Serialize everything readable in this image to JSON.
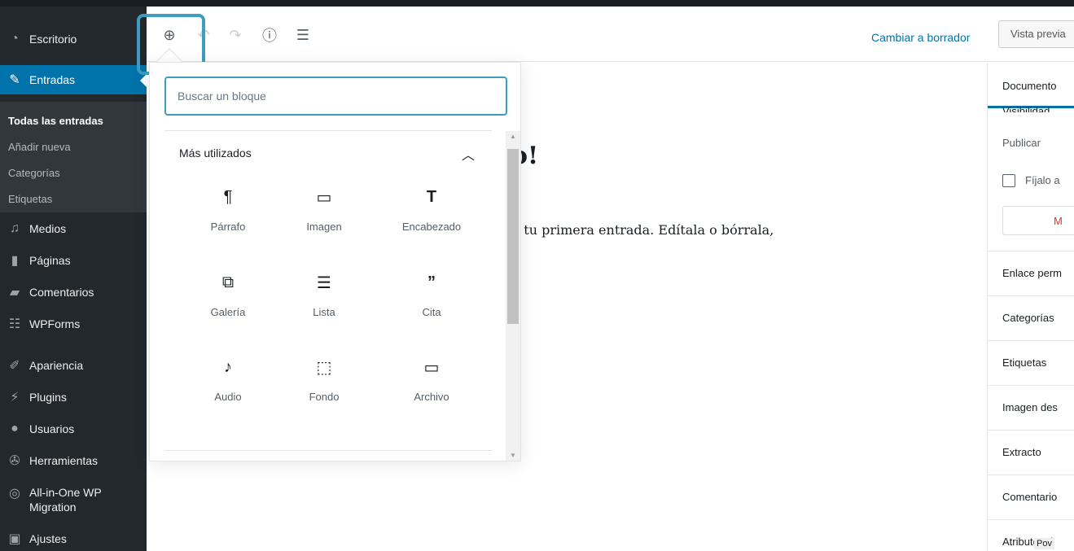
{
  "sidebar": {
    "items": [
      {
        "label": "Escritorio",
        "icon": "dashboard-icon"
      },
      {
        "label": "Entradas",
        "icon": "pin-icon"
      },
      {
        "label": "Medios",
        "icon": "media-icon"
      },
      {
        "label": "Páginas",
        "icon": "pages-icon"
      },
      {
        "label": "Comentarios",
        "icon": "comments-icon"
      },
      {
        "label": "WPForms",
        "icon": "wpforms-icon"
      },
      {
        "label": "Apariencia",
        "icon": "appearance-icon"
      },
      {
        "label": "Plugins",
        "icon": "plugins-icon"
      },
      {
        "label": "Usuarios",
        "icon": "users-icon"
      },
      {
        "label": "Herramientas",
        "icon": "tools-icon"
      },
      {
        "label": "All-in-One WP Migration",
        "line1": "All-in-One WP",
        "line2": "Migration",
        "icon": "migration-icon"
      },
      {
        "label": "Ajustes",
        "icon": "settings-icon"
      }
    ],
    "submenu": [
      "Todas las entradas",
      "Añadir nueva",
      "Categorías",
      "Etiquetas"
    ]
  },
  "header": {
    "switch_draft": "Cambiar a borrador",
    "preview": "Vista previa"
  },
  "post": {
    "title_fragment": "o!",
    "body_fragment": "s tu primera entrada. Edítala o bórrala,"
  },
  "inserter": {
    "search_placeholder": "Buscar un bloque",
    "section_title": "Más utilizados",
    "blocks": [
      {
        "label": "Párrafo",
        "icon": "paragraph-icon"
      },
      {
        "label": "Imagen",
        "icon": "image-icon"
      },
      {
        "label": "Encabezado",
        "icon": "heading-icon"
      },
      {
        "label": "Galería",
        "icon": "gallery-icon"
      },
      {
        "label": "Lista",
        "icon": "list-icon"
      },
      {
        "label": "Cita",
        "icon": "quote-icon"
      },
      {
        "label": "Audio",
        "icon": "audio-icon"
      },
      {
        "label": "Fondo",
        "icon": "cover-icon"
      },
      {
        "label": "Archivo",
        "icon": "file-icon"
      }
    ]
  },
  "settings_panel": {
    "tab": "Documento",
    "visibility_cut": "Visibilidad",
    "publish": "Publicar",
    "sticky": "Fíjalo a",
    "trash": "M",
    "panels": [
      "Enlace perm",
      "Categorías",
      "Etiquetas",
      "Imagen des",
      "Extracto",
      "Comentario",
      "Atributos d"
    ]
  },
  "tooltip_fragment": "Pov",
  "colors": {
    "sidebar_bg": "#23282d",
    "active_bg": "#0073aa",
    "highlight": "#3d9cc0",
    "link": "#0073aa"
  }
}
